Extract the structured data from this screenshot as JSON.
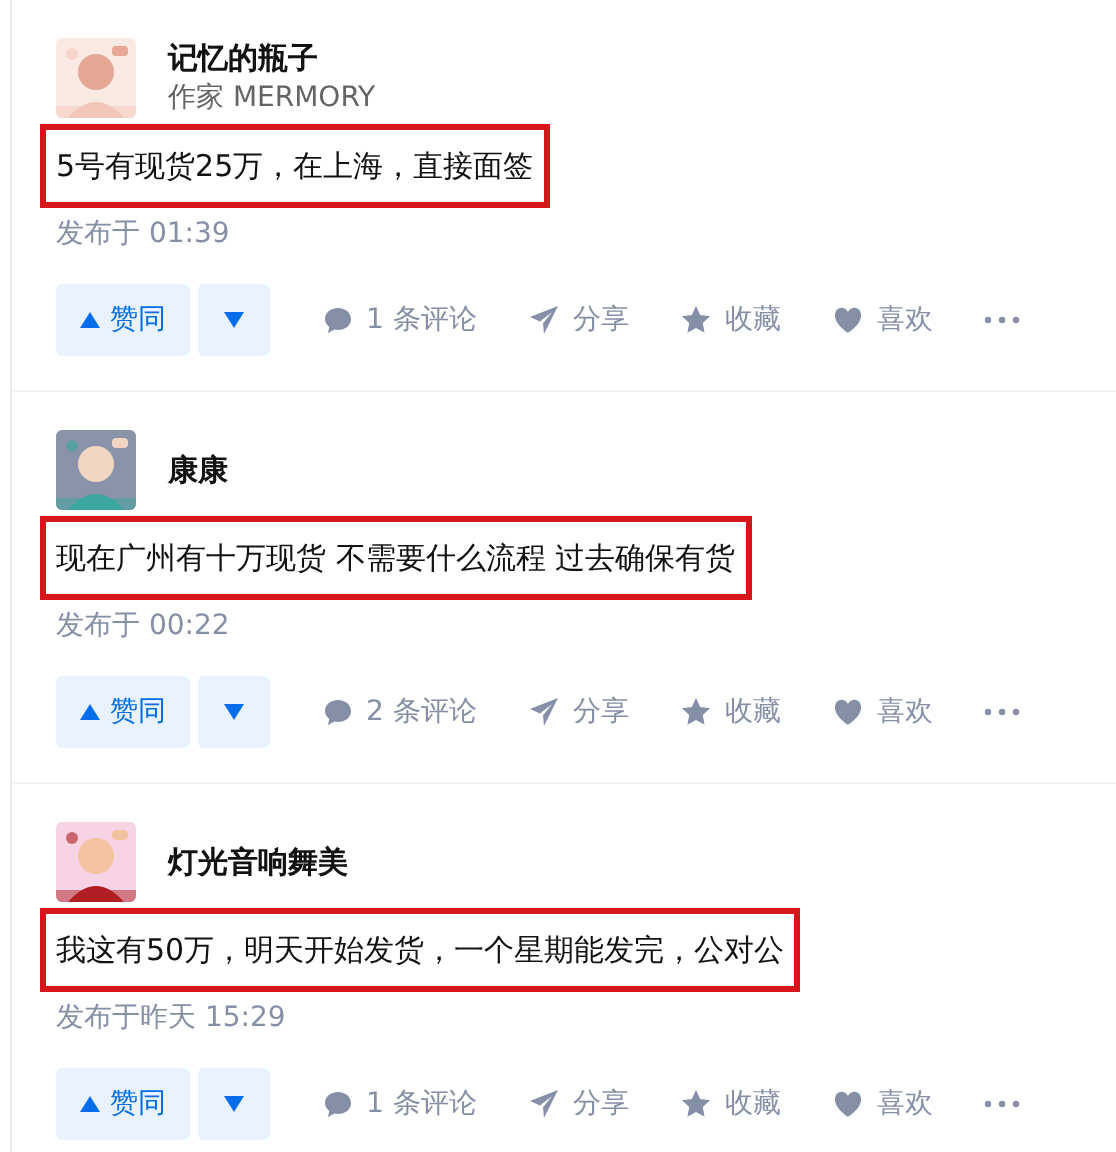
{
  "answers": [
    {
      "author": "记忆的瓶子",
      "headline": "作家 MERMORY",
      "content": "5号有现货25万，在上海，直接面签",
      "highlighted": true,
      "time": "发布于 01:39",
      "upvote": "赞同",
      "comments": "1 条评论",
      "share": "分享",
      "collect": "收藏",
      "like": "喜欢"
    },
    {
      "author": "康康",
      "content": "现在广州有十万现货 不需要什么流程 过去确保有货",
      "highlighted": true,
      "time": "发布于 00:22",
      "upvote": "赞同",
      "comments": "2 条评论",
      "share": "分享",
      "collect": "收藏",
      "like": "喜欢"
    },
    {
      "author": "灯光音响舞美",
      "content": "我这有50万，明天开始发货，一个星期能发完，公对公",
      "highlighted": true,
      "time": "发布于昨天 15:29",
      "upvote": "赞同",
      "comments": "1 条评论",
      "share": "分享",
      "collect": "收藏",
      "like": "喜欢"
    }
  ]
}
